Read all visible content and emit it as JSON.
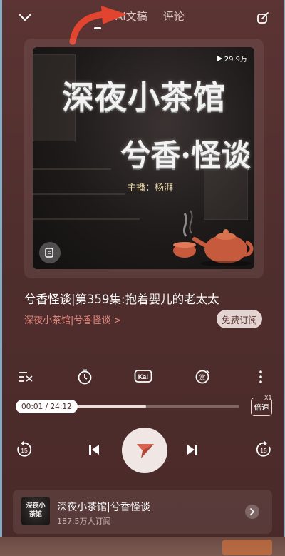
{
  "header": {
    "tabs": [
      {
        "label": "AI文稿",
        "active": false
      },
      {
        "label": "评论",
        "active": false
      }
    ]
  },
  "cover": {
    "title_line1": "深夜小茶馆",
    "title_line2": "兮香·怪谈",
    "host": "主播：杨湃",
    "play_count": "29.9万"
  },
  "episode": {
    "title": "兮香怪谈|第359集:抱着婴儿的老太太",
    "album_link": "深夜小茶馆|兮香怪谈 >",
    "subscribe_label": "免费订阅"
  },
  "player": {
    "time": "00:01 / 24:12",
    "progress_fraction": 0.58,
    "speed_label": "倍速",
    "speed_value": "X1",
    "rewind_label": "15",
    "forward_label": "15"
  },
  "album_card": {
    "thumb_line1": "深夜小",
    "thumb_line2": "茶馆",
    "name": "深夜小茶馆|兮香怪谈",
    "subscribers": "187.5万人订阅"
  },
  "colors": {
    "background": "#4f2e2d",
    "accent_link": "#e7897f",
    "arrow": "#e2452f"
  },
  "icons": [
    "chevron-down-icon",
    "share-icon",
    "shuffle-list-icon",
    "timer-icon",
    "karaoke-icon",
    "reward-icon",
    "more-icon",
    "rewind-15-icon",
    "previous-icon",
    "play-icon",
    "next-icon",
    "forward-15-icon"
  ]
}
